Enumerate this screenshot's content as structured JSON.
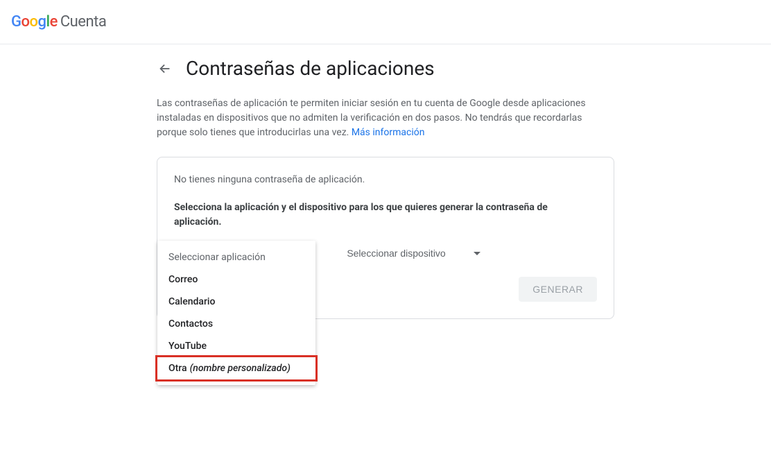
{
  "header": {
    "logo_product": "Cuenta"
  },
  "page": {
    "title": "Contraseñas de aplicaciones",
    "description_prefix": "Las contraseñas de aplicación te permiten iniciar sesión en tu cuenta de Google desde aplicaciones instaladas en dispositivos que no admiten la verificación en dos pasos. No tendrás que recordarlas porque solo tienes que introducirlas una vez. ",
    "more_info_link": "Más información"
  },
  "card": {
    "no_passwords_msg": "No tienes ninguna contraseña de aplicación.",
    "instruction": "Selecciona la aplicación y el dispositivo para los que quieres generar la contraseña de aplicación.",
    "select_app_label": "Seleccionar aplicación",
    "select_device_label": "Seleccionar dispositivo",
    "generate_button": "GENERAR"
  },
  "app_dropdown": {
    "header": "Seleccionar aplicación",
    "options": [
      {
        "label": "Correo"
      },
      {
        "label": "Calendario"
      },
      {
        "label": "Contactos"
      },
      {
        "label": "YouTube"
      },
      {
        "label": "Otra",
        "custom_suffix": "(nombre personalizado)",
        "highlighted": true
      }
    ]
  }
}
